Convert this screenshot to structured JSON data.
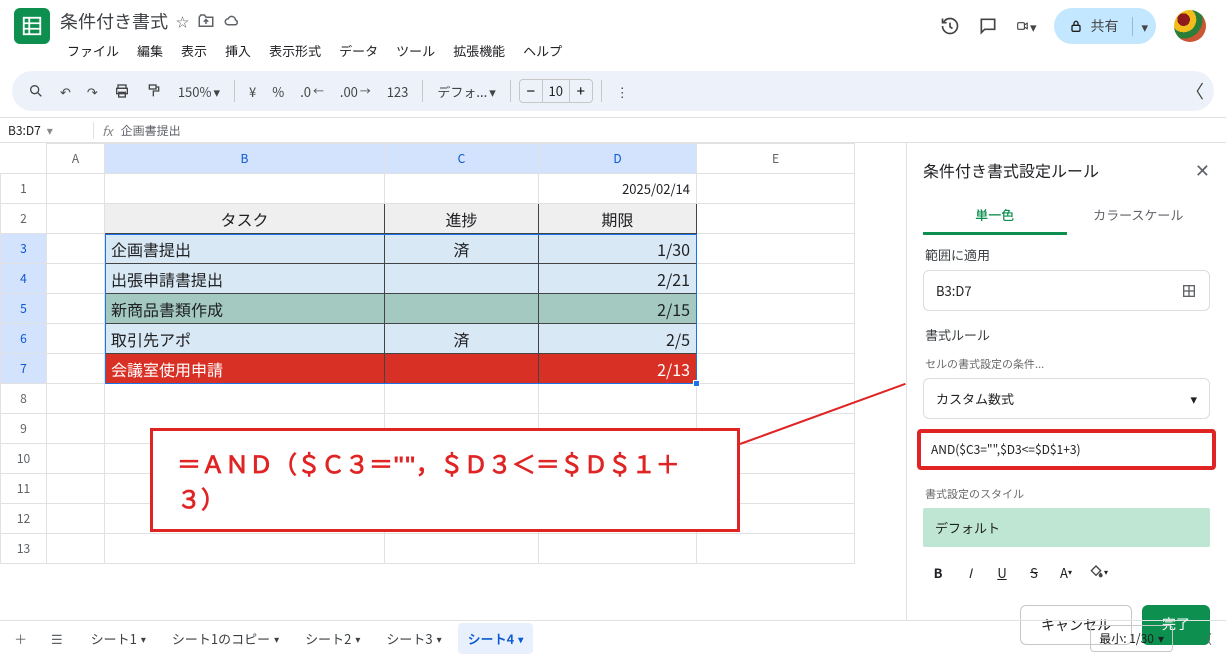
{
  "header": {
    "doc_title": "条件付き書式",
    "menus": [
      "ファイル",
      "編集",
      "表示",
      "挿入",
      "表示形式",
      "データ",
      "ツール",
      "拡張機能",
      "ヘルプ"
    ],
    "share_label": "共有"
  },
  "toolbar": {
    "zoom": "150%",
    "font": "デフォ...",
    "font_size": "10"
  },
  "formula_bar": {
    "namebox": "B3:D7",
    "value": "企画書提出"
  },
  "columns": [
    "A",
    "B",
    "C",
    "D",
    "E"
  ],
  "rows": [
    {
      "r": "1",
      "D": "2025/02/14"
    },
    {
      "r": "2",
      "B": "タスク",
      "C": "進捗",
      "D": "期限",
      "header": true
    },
    {
      "r": "3",
      "B": "企画書提出",
      "C": "済",
      "D": "1/30",
      "style": "pale"
    },
    {
      "r": "4",
      "B": "出張申請書提出",
      "C": "",
      "D": "2/21",
      "style": "pale"
    },
    {
      "r": "5",
      "B": "新商品書類作成",
      "C": "",
      "D": "2/15",
      "style": "teal"
    },
    {
      "r": "6",
      "B": "取引先アポ",
      "C": "済",
      "D": "2/5",
      "style": "pale"
    },
    {
      "r": "7",
      "B": "会議室使用申請",
      "C": "",
      "D": "2/13",
      "style": "redrow"
    }
  ],
  "empty_rows": [
    "8",
    "9",
    "10",
    "11",
    "12",
    "13"
  ],
  "annotation": {
    "text": "＝ＡＮＤ（＄Ｃ３＝\"\"，＄Ｄ３＜＝＄Ｄ＄１＋３）"
  },
  "panel": {
    "title": "条件付き書式設定ルール",
    "tab_single": "単一色",
    "tab_scale": "カラースケール",
    "apply_label": "範囲に適用",
    "range": "B3:D7",
    "rule_label": "書式ルール",
    "cell_cond_label": "セルの書式設定の条件...",
    "cond_value": "カスタム数式",
    "formula": "AND($C3=\"\",$D3<=$D$1+3)",
    "style_label": "書式設定のスタイル",
    "style_preview": "デフォルト",
    "cancel": "キャンセル",
    "done": "完了"
  },
  "tabs": {
    "items": [
      "シート1",
      "シート1のコピー",
      "シート2",
      "シート3",
      "シート4"
    ],
    "active": 4,
    "min": "最小: 1/30"
  }
}
